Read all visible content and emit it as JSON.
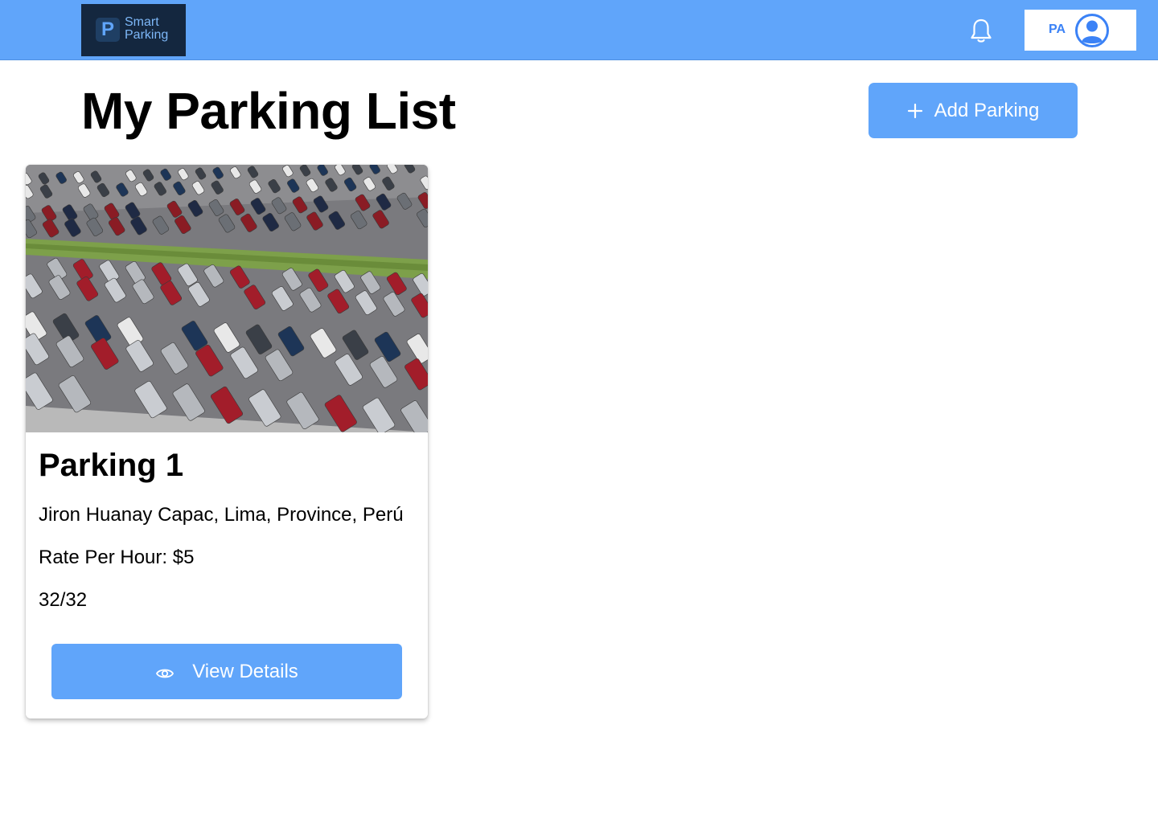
{
  "header": {
    "logo": {
      "mark": "P",
      "line1": "Smart",
      "line2": "Parking"
    },
    "notification_icon": "bell-icon",
    "user": {
      "initials": "PA",
      "avatar_icon": "user-circle-icon"
    }
  },
  "main": {
    "title": "My Parking List",
    "add_button": {
      "icon": "plus-icon",
      "label": "Add Parking"
    }
  },
  "parkings": [
    {
      "image": "parking-lot-photo",
      "name": "Parking 1",
      "address": "Jiron Huanay Capac, Lima, Province, Perú",
      "rate": "Rate Per Hour: $5",
      "capacity": "32/32",
      "view_button": {
        "icon": "eye-icon",
        "label": "View Details"
      }
    }
  ],
  "colors": {
    "header_bg": "#60a5fa",
    "button_bg": "#60a5fa",
    "logo_bg": "#14273f",
    "accent": "#3b82f6"
  }
}
